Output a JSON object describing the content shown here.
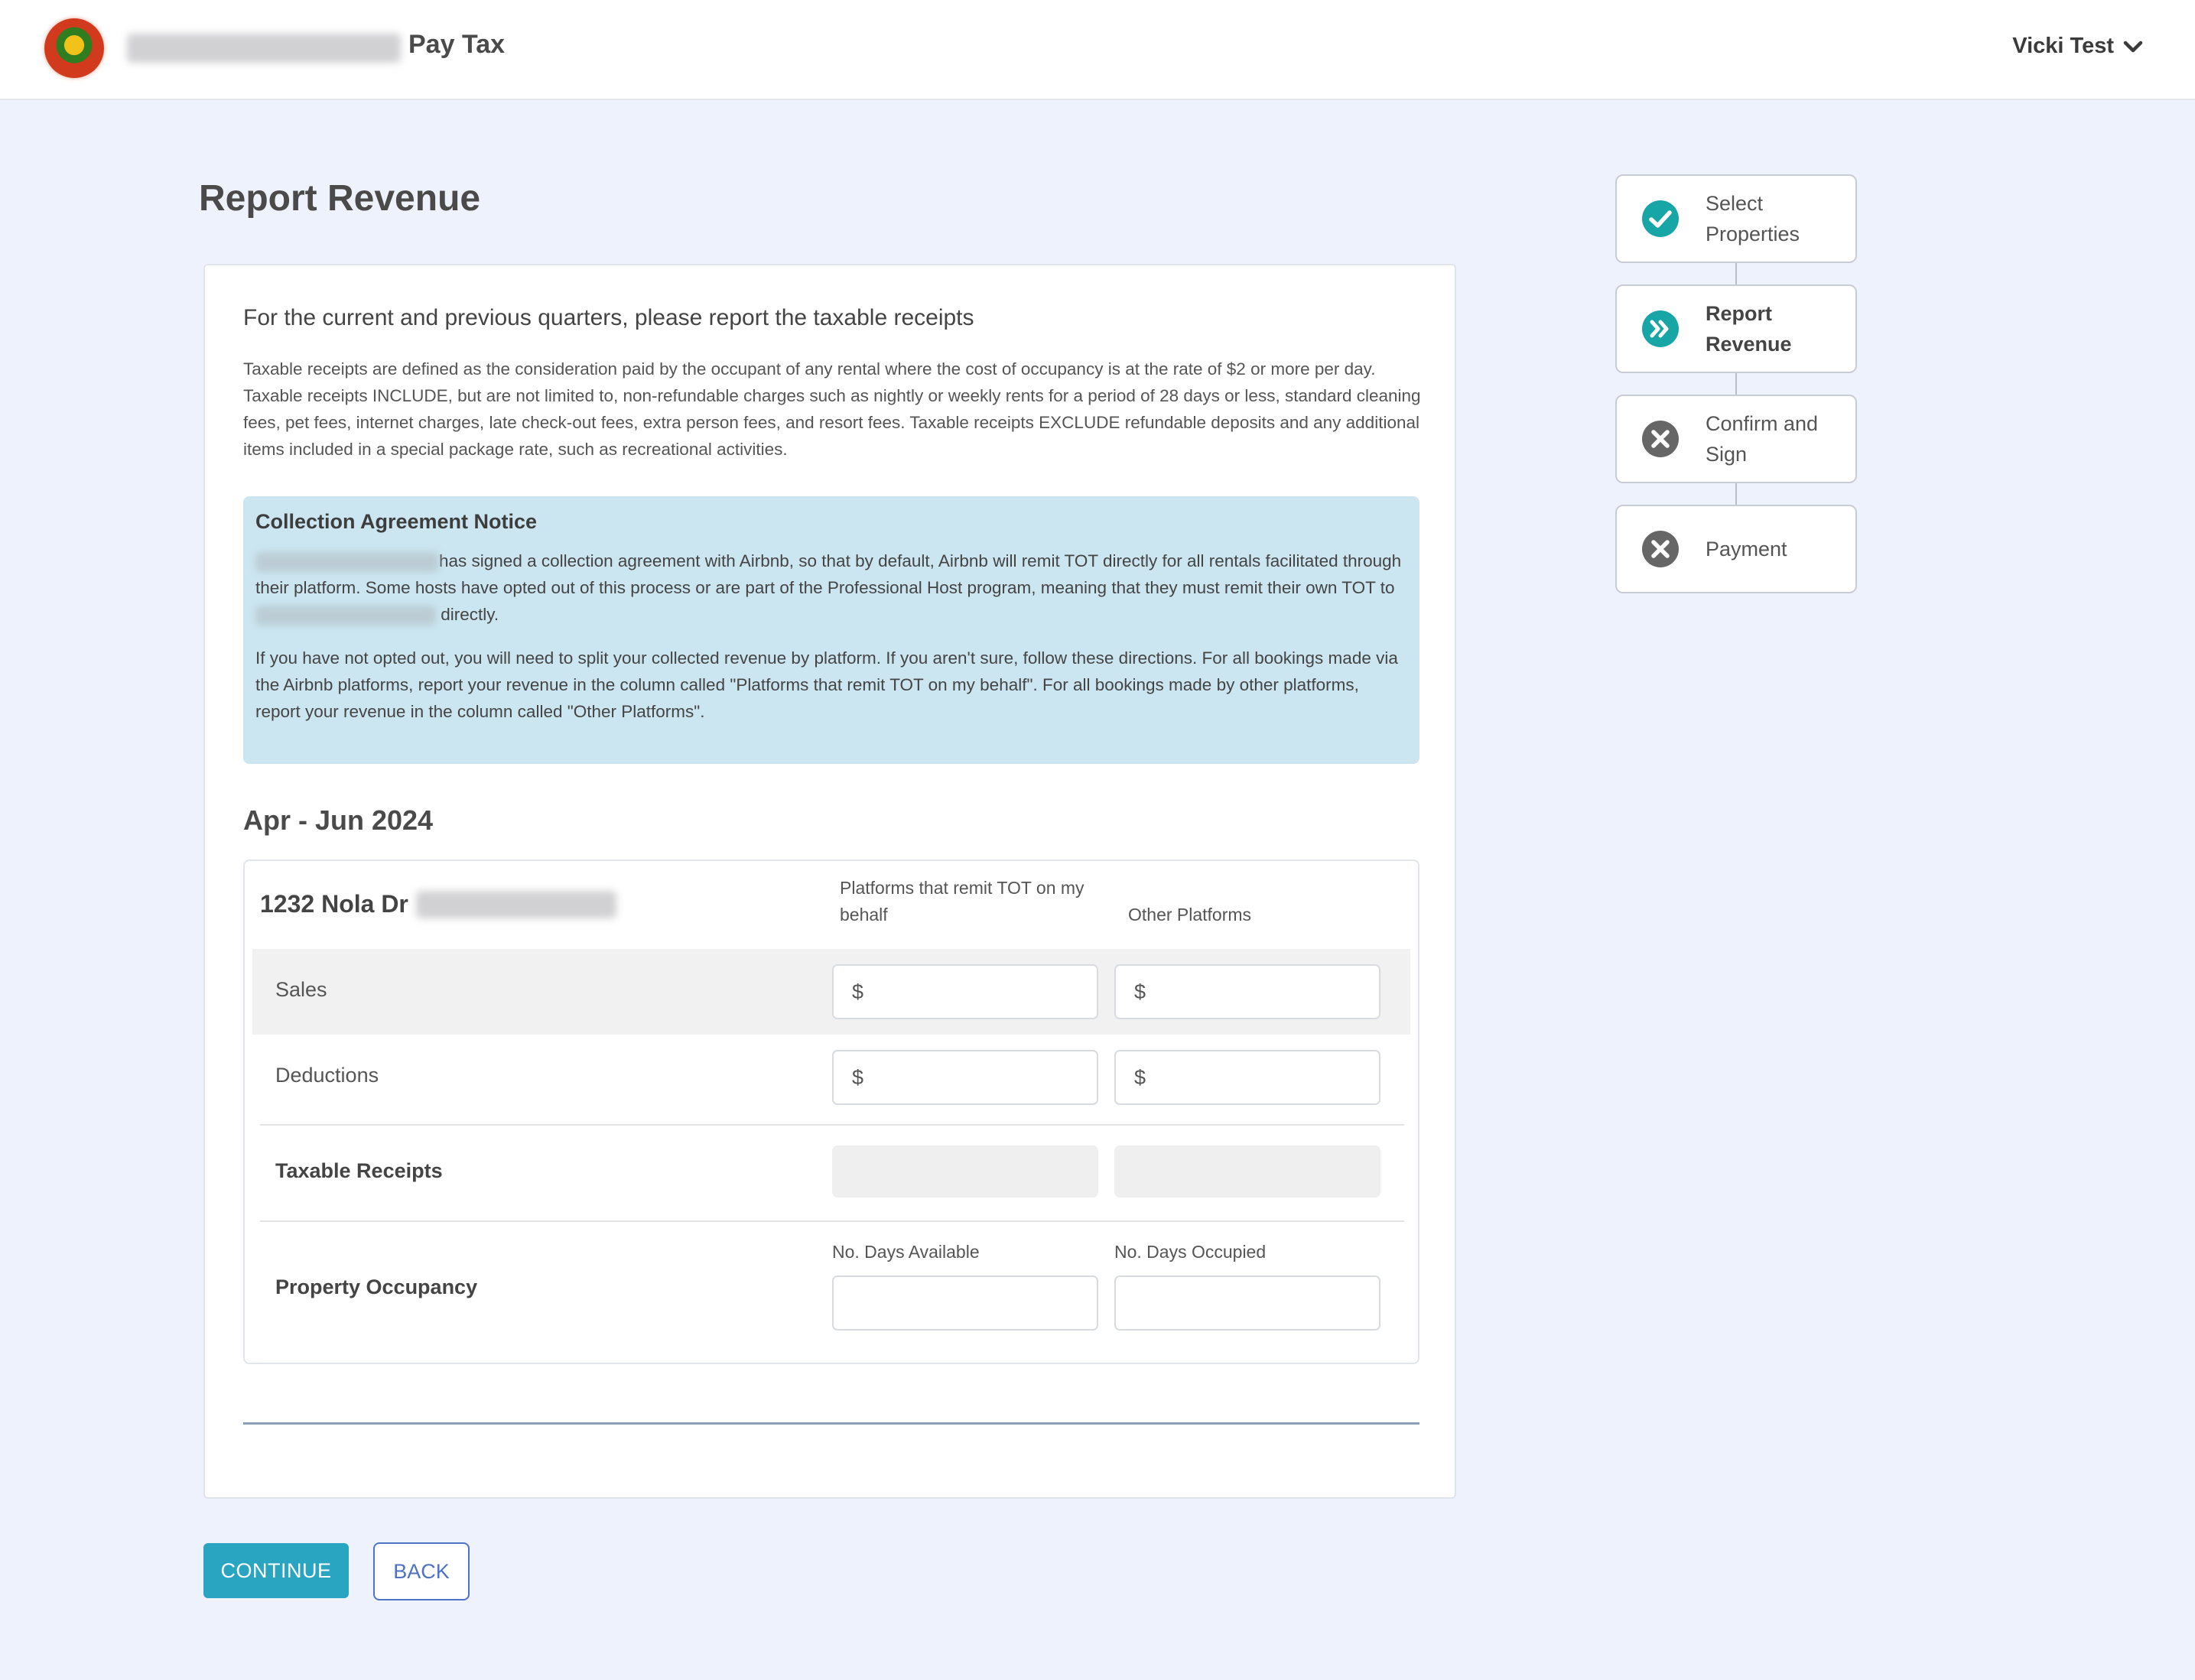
{
  "header": {
    "app_title": "Pay Tax",
    "user_name": "Vicki Test"
  },
  "page": {
    "title": "Report Revenue"
  },
  "intro": {
    "heading": "For the current and previous quarters, please report the taxable receipts",
    "text": "Taxable receipts are defined as the consideration paid by the occupant of any rental where the cost of occupancy is at the rate of $2 or more per day. Taxable receipts INCLUDE, but are not limited to, non-refundable charges such as nightly or weekly rents for a period of 28 days or less, standard cleaning fees, pet fees, internet charges, late check-out fees, extra person fees, and resort fees. Taxable receipts EXCLUDE refundable deposits and any additional items included in a special package rate, such as recreational activities."
  },
  "notice": {
    "title": "Collection Agreement Notice",
    "p1_part1": "has signed a collection agreement with Airbnb, so that by default, Airbnb will remit TOT directly for all rentals facilitated through their platform. Some hosts have opted out of this process or are part of the Professional Host program, meaning that they must remit their own TOT to",
    "p1_part2": "directly.",
    "p2": "If you have not opted out, you will need to split your collected revenue by platform. If you aren't sure, follow these directions. For all bookings made via the Airbnb platforms, report your revenue in the column called \"Platforms that remit TOT on my behalf\". For all bookings made by other platforms, report your revenue in the column called \"Other Platforms\"."
  },
  "quarter": {
    "label": "Apr - Jun 2024",
    "property": {
      "address": "1232 Nola Dr",
      "col_platforms": "Platforms that remit TOT on my behalf",
      "col_other": "Other Platforms",
      "rows": {
        "sales": "Sales",
        "deductions": "Deductions",
        "taxable": "Taxable Receipts",
        "occupancy": "Property Occupancy"
      },
      "currency_symbol": "$",
      "days_available_label": "No. Days Available",
      "days_occupied_label": "No. Days Occupied"
    }
  },
  "actions": {
    "continue_label": "CONTINUE",
    "back_label": "BACK"
  },
  "stepper": {
    "steps": [
      {
        "label": "Select Properties",
        "status": "complete",
        "icon": "check-circle-icon"
      },
      {
        "label": "Report Revenue",
        "status": "current",
        "icon": "double-chevron-circle-icon"
      },
      {
        "label": "Confirm and Sign",
        "status": "incomplete",
        "icon": "x-circle-icon"
      },
      {
        "label": "Payment",
        "status": "incomplete",
        "icon": "x-circle-icon"
      }
    ]
  },
  "colors": {
    "accent": "#2aa5c1",
    "teal_icon": "#17a5a5",
    "notice_bg": "#cbe6f1",
    "page_bg": "#eef2fc",
    "back_border": "#4e72c4"
  }
}
